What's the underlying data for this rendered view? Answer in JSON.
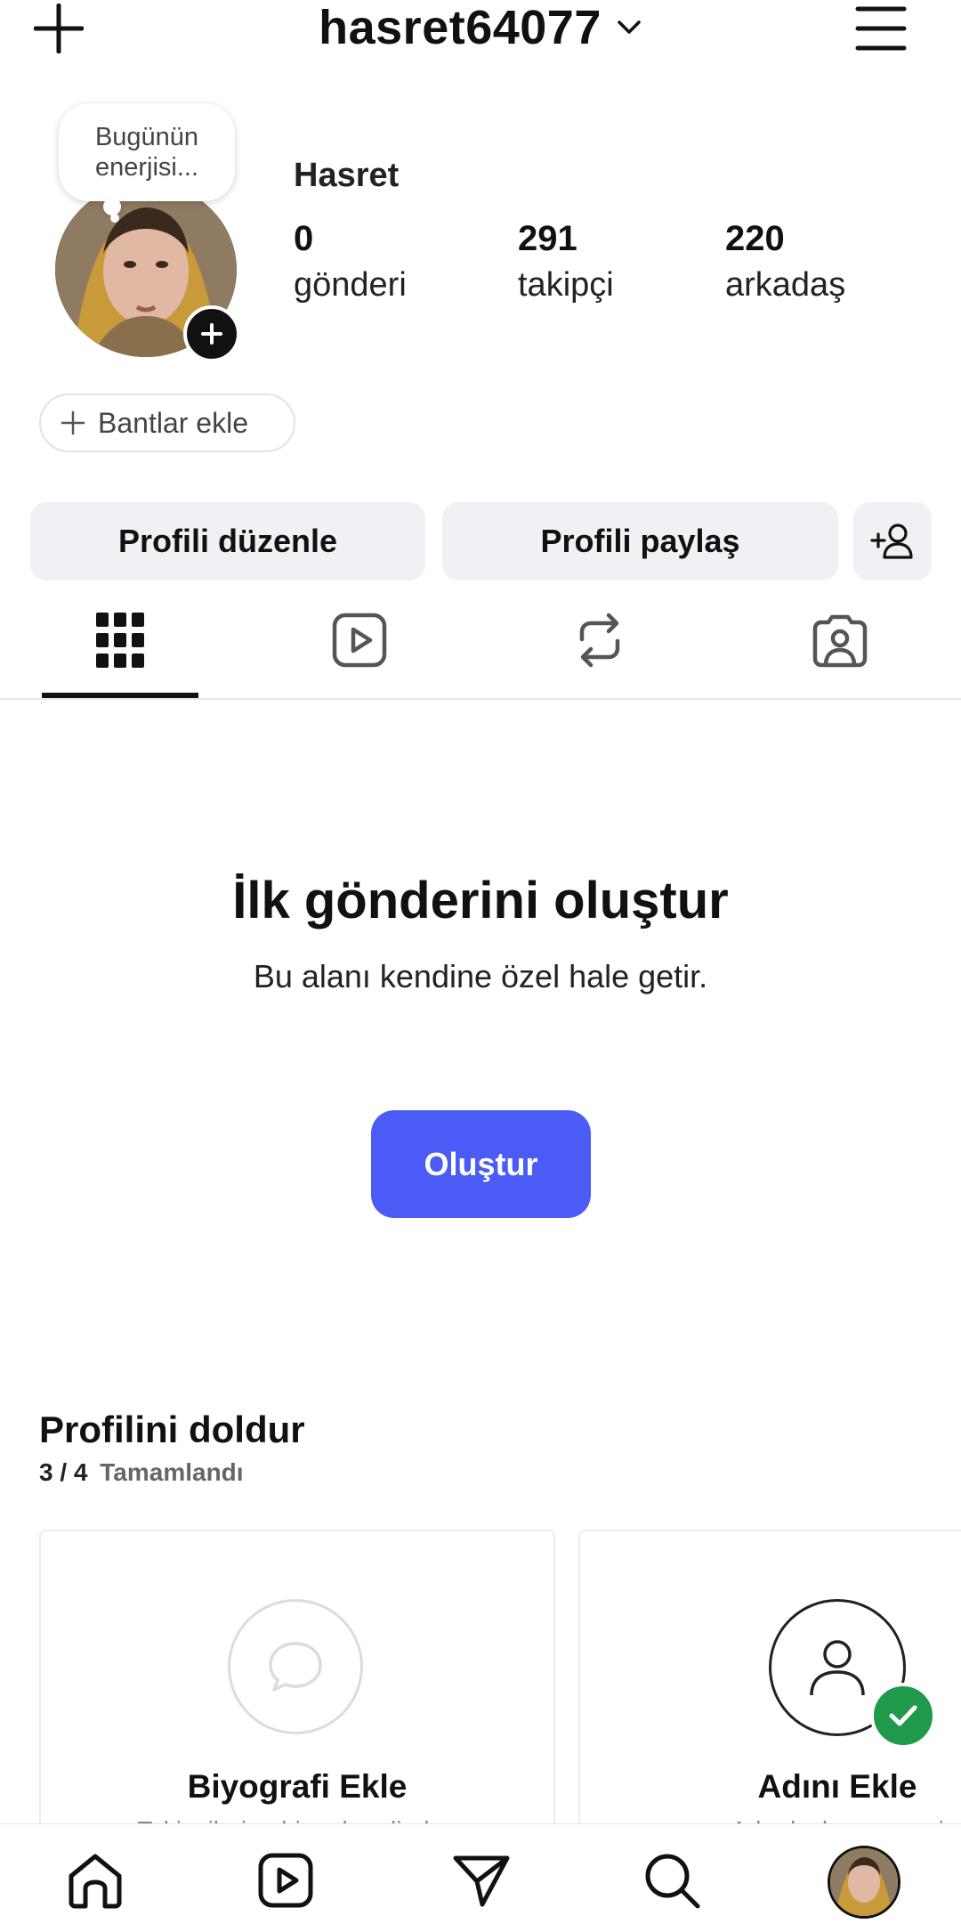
{
  "header": {
    "username": "hasret64077"
  },
  "profile": {
    "note_bubble": "Bugünün\nenerjisi...",
    "display_name": "Hasret",
    "stats": [
      {
        "value": "0",
        "label": "gönderi"
      },
      {
        "value": "291",
        "label": "takipçi"
      },
      {
        "value": "220",
        "label": "arkadaş"
      }
    ],
    "add_bands_label": "Bantlar ekle"
  },
  "actions": {
    "edit_profile": "Profili düzenle",
    "share_profile": "Profili paylaş"
  },
  "tabs": [
    {
      "icon": "grid-icon",
      "active": true
    },
    {
      "icon": "reels-icon",
      "active": false
    },
    {
      "icon": "repost-icon",
      "active": false
    },
    {
      "icon": "tagged-icon",
      "active": false
    }
  ],
  "empty_state": {
    "title": "İlk gönderini oluştur",
    "subtitle": "Bu alanı kendine özel hale getir.",
    "button": "Oluştur"
  },
  "complete_profile": {
    "title": "Profilini doldur",
    "progress": "3 / 4",
    "progress_suffix": "Tamamlandı",
    "cards": [
      {
        "title": "Biyografi Ekle",
        "desc": "Takipçilerine biraz kendinden",
        "icon": "speech-bubble-icon",
        "done": false
      },
      {
        "title": "Adını Ekle",
        "desc": "Arkadaşlarının seni",
        "icon": "user-icon",
        "done": true
      }
    ]
  },
  "colors": {
    "accent": "#4a5cf5",
    "success": "#1f9a4a",
    "chip_bg": "#eff1f4"
  },
  "bottom_nav": [
    "home-icon",
    "reels-icon",
    "direct-icon",
    "search-icon",
    "profile-avatar"
  ]
}
